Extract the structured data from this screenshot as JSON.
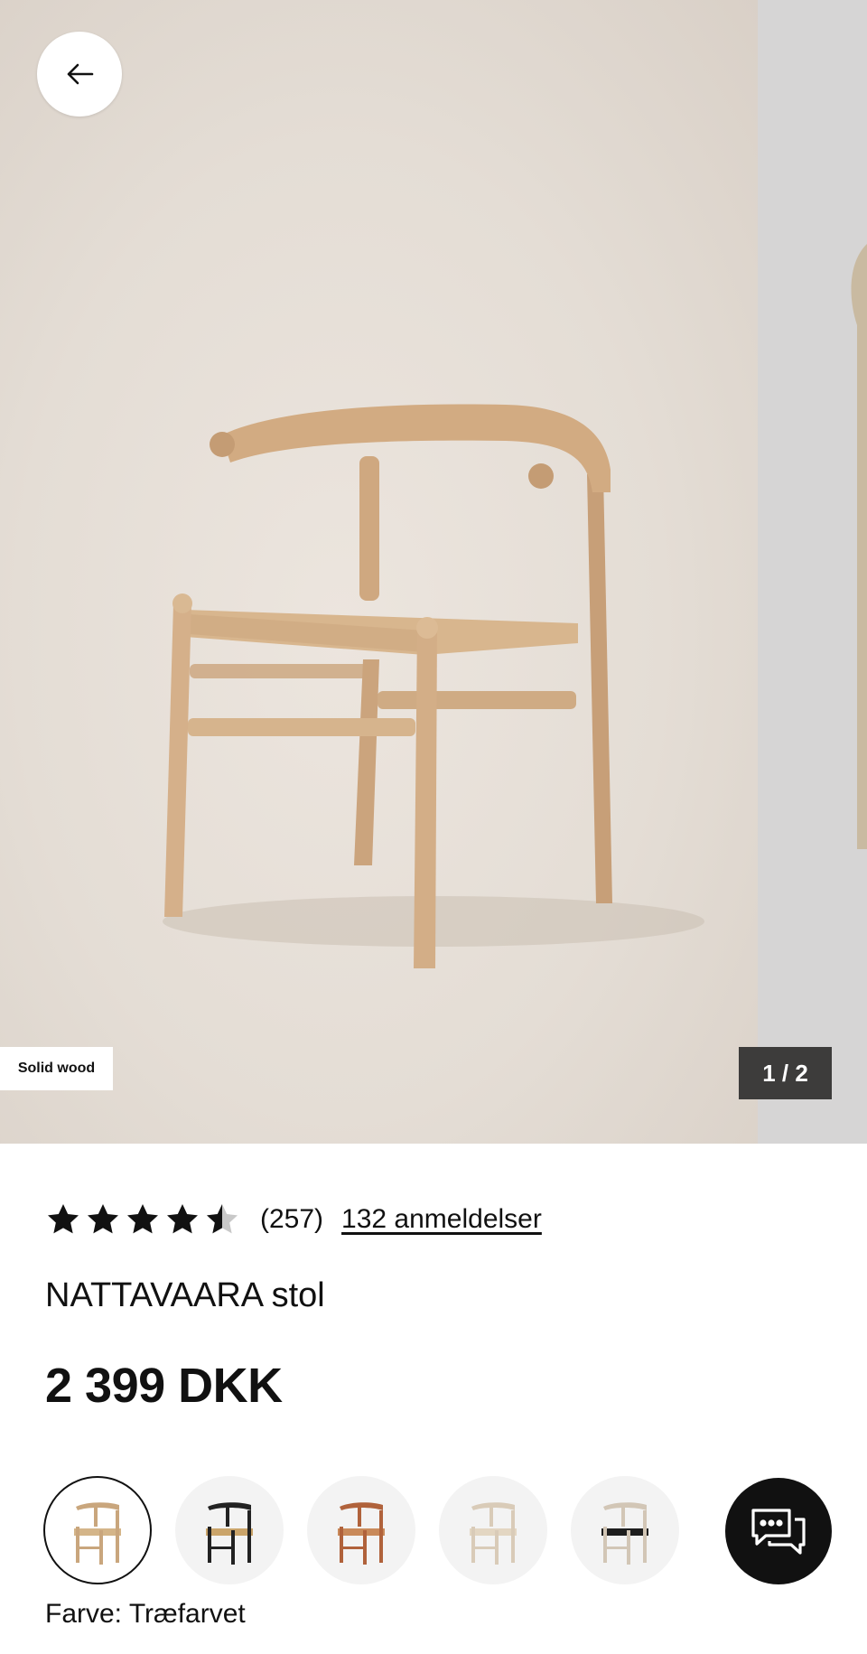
{
  "gallery": {
    "badge": "Solid wood",
    "counter": "1 / 2"
  },
  "product": {
    "rating_value": 4.5,
    "rating_count": "(257)",
    "reviews_link": "132 anmeldelser",
    "title": "NATTAVAARA stol",
    "price": "2 399 DKK",
    "color_label": "Farve: Træfarvet"
  },
  "swatches": [
    {
      "frame": "#c9a67d",
      "seat": "#d4b589",
      "selected": true
    },
    {
      "frame": "#222222",
      "seat": "#caa46a",
      "selected": false
    },
    {
      "frame": "#b0623b",
      "seat": "#c98a5a",
      "selected": false
    },
    {
      "frame": "#d9cbb8",
      "seat": "#e3d6c2",
      "selected": false
    },
    {
      "frame": "#d2c6b6",
      "seat": "#1e1e1e",
      "selected": false
    }
  ],
  "colors": {
    "text": "#111111",
    "counter_bg": "#3d3c3b",
    "chat_bg": "#111111"
  },
  "icons": {
    "back": "arrow-left-icon",
    "chat": "chat-bubbles-icon",
    "star": "star-icon"
  }
}
